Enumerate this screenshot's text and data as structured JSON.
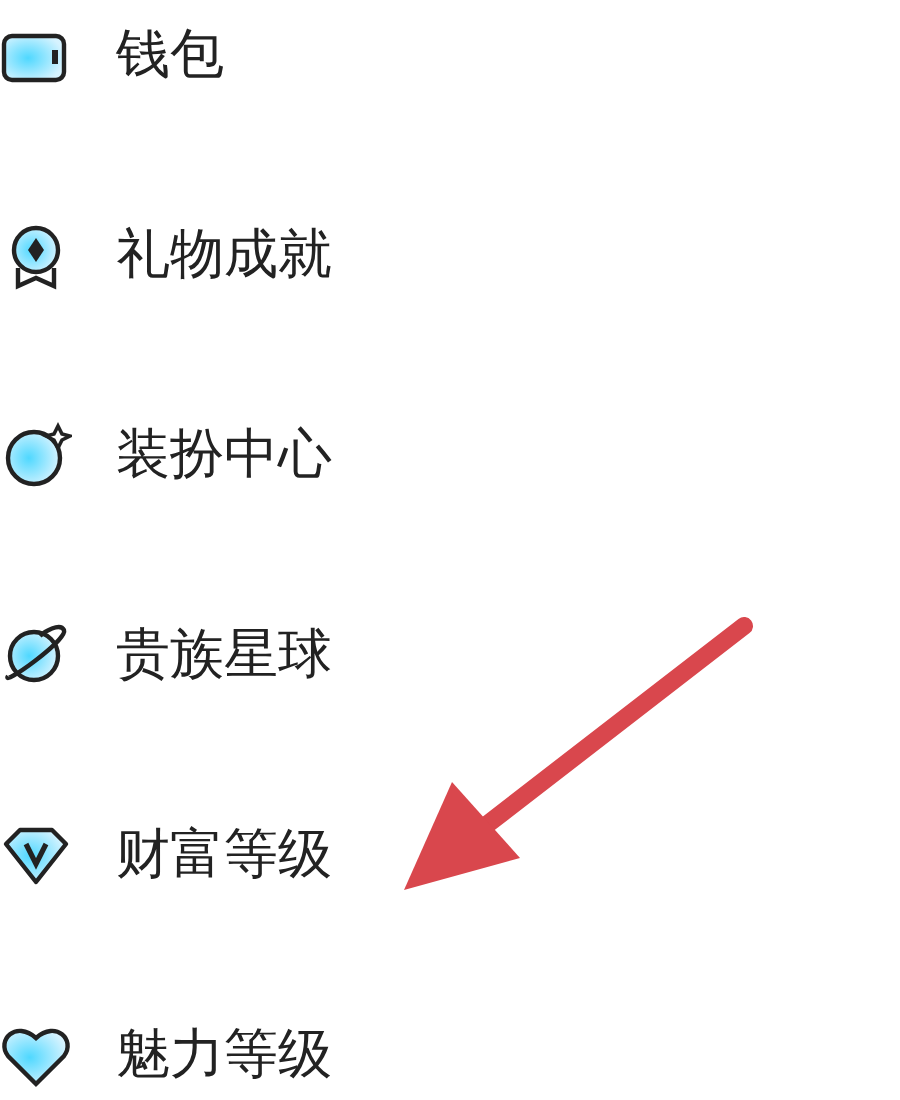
{
  "menu": [
    {
      "label": "钱包",
      "kind": "wallet"
    },
    {
      "label": "礼物成就",
      "kind": "medal"
    },
    {
      "label": "装扮中心",
      "kind": "planet"
    },
    {
      "label": "贵族星球",
      "kind": "orbit"
    },
    {
      "label": "财富等级",
      "kind": "diamond"
    },
    {
      "label": "魅力等级",
      "kind": "heart"
    }
  ]
}
